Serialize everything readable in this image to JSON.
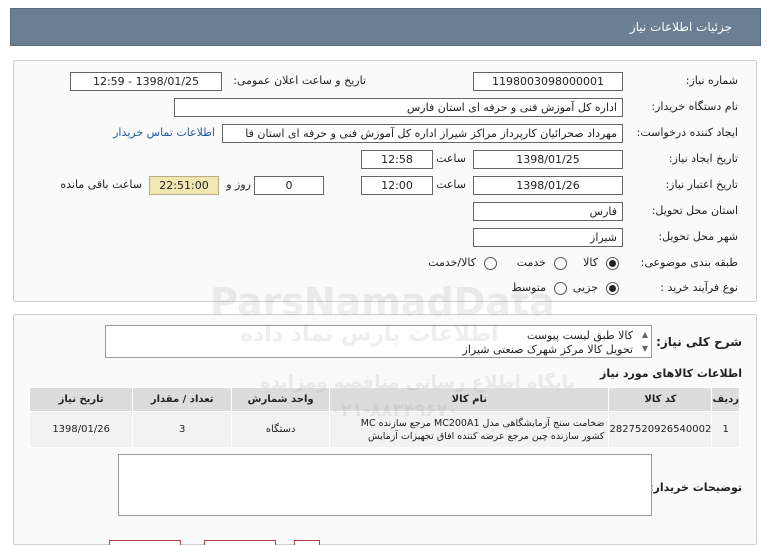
{
  "header": {
    "title": "جزئیات اطلاعات نیاز"
  },
  "form": {
    "need_number_label": "شماره نیاز:",
    "need_number": "1198003098000001",
    "announce_label": "تاریخ و ساعت اعلان عمومی:",
    "announce_value": "1398/01/25 - 12:59",
    "buyer_label": "نام دستگاه خریدار:",
    "buyer_value": "اداره کل آموزش فنی و حرفه ای استان فارس",
    "creator_label": "ایجاد کننده درخواست:",
    "creator_value": "مهرداد صحرائیان کارپرداز مراکز  شیراز اداره کل آموزش فنی و حرفه ای استان فا",
    "contact_link": "اطلاعات تماس خریدار",
    "created_label": "تاریخ ایجاد نیاز:",
    "created_date": "1398/01/25",
    "time_label": "ساعت",
    "created_time": "12:58",
    "validity_label": "تاریخ اعتبار نیاز:",
    "validity_date": "1398/01/26",
    "validity_time": "12:00",
    "days_value": "0",
    "day_label": "روز و",
    "remaining_time": "22:51:00",
    "remaining_label": "ساعت باقی مانده",
    "province_label": "استان محل تحویل:",
    "province_value": "فارس",
    "city_label": "شهر محل تحویل:",
    "city_value": "شیراز",
    "category_label": "طبقه بندی موضوعی:",
    "category_options": [
      "کالا",
      "خدمت",
      "کالا/خدمت"
    ],
    "process_label": "نوع فرآیند خرید :",
    "process_options": [
      "جزیی",
      "متوسط"
    ]
  },
  "summary": {
    "label": "شرح کلی نیاز:",
    "line1": "کالا طبق لیست پیوست",
    "line2": "تحویل کالا مرکز  شهرک صنعتی شیراز"
  },
  "goods": {
    "title": "اطلاعات کالاهای مورد نیاز",
    "headers": [
      "ردیف",
      "کد کالا",
      "نام کالا",
      "واحد شمارش",
      "تعداد / مقدار",
      "تاریخ نیاز"
    ],
    "row": {
      "index": "1",
      "code": "2827520926540002",
      "name_line1": "ضخامت سنج آزمایشگاهی مدل MC200A1 مرجع سازنده MC",
      "name_line2": "کشور سازنده چین مرجع عرضه کننده افاق تجهیزات آزمایش",
      "unit": "دستگاه",
      "qty": "3",
      "date": "1398/01/26"
    }
  },
  "notes": {
    "label": "توضیحات خریدار:"
  },
  "watermark": {
    "line1": "ParsNamadData",
    "line2": "اطلاعات پارس نماد داده",
    "line3": "پایگاه اطلاع رسانی مناقصه ومزایده",
    "line4": "۰۲۱-۸۸۳۴۹۶۷۰"
  }
}
